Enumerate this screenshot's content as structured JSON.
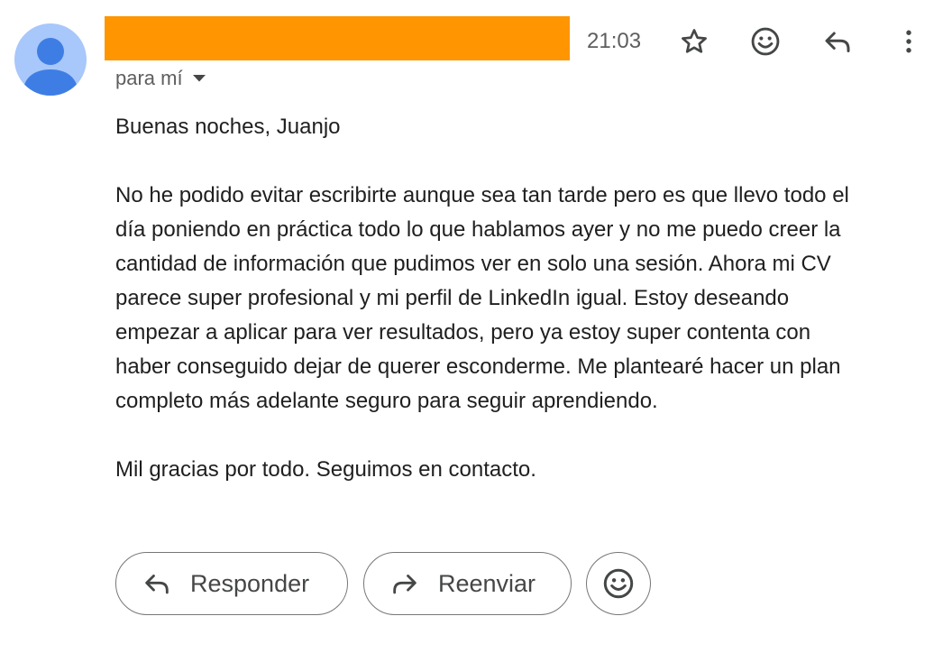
{
  "header": {
    "time": "21:03",
    "recipient_label": "para mí",
    "redaction_color": "#ff9500"
  },
  "icons": {
    "star": "star-icon",
    "emoji": "emoji-icon",
    "reply": "reply-icon",
    "more": "more-vert-icon",
    "caret": "caret-down-icon",
    "forward": "forward-icon"
  },
  "email": {
    "greeting": "Buenas noches, Juanjo",
    "body_lines": [
      "No he podido evitar escribirte aunque sea tan tarde pero es que llevo todo el",
      "día poniendo en práctica todo lo que hablamos ayer y no me puedo creer la",
      "cantidad de información que pudimos ver en solo una sesión. Ahora mi CV",
      "parece super profesional y mi perfil de LinkedIn igual. Estoy deseando",
      "empezar a aplicar para ver resultados, pero ya estoy super contenta con",
      "haber conseguido dejar de querer esconderme. Me plantearé hacer un plan",
      "completo más adelante seguro para seguir aprendiendo."
    ],
    "closing": "Mil gracias por todo. Seguimos en contacto."
  },
  "actions": {
    "reply_label": "Responder",
    "forward_label": "Reenviar"
  },
  "colors": {
    "avatar_bg": "#a8c7fa",
    "avatar_fg": "#3e7ee4",
    "text": "#1f1f1f",
    "muted": "#5e5e5e",
    "icon": "#444746",
    "pill_border": "#747775"
  }
}
